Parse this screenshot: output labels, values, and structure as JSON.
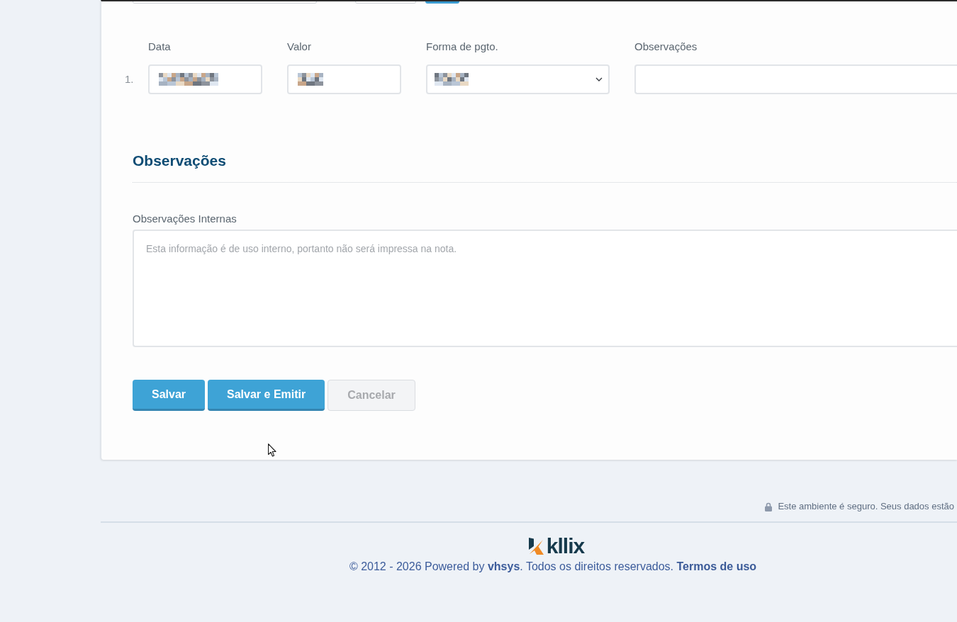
{
  "top_row": [
    {
      "kind": "input"
    },
    {
      "kind": "input"
    },
    {
      "kind": "button"
    }
  ],
  "payments": {
    "columns": [
      "Data",
      "Valor",
      "Forma de pgto.",
      "Observações"
    ],
    "rows": [
      {
        "number": "1.",
        "fields": [
          {
            "kind": "input",
            "redacted": true
          },
          {
            "kind": "input",
            "redacted": true
          },
          {
            "kind": "select",
            "redacted": true
          },
          {
            "kind": "input",
            "redacted": false
          }
        ]
      }
    ]
  },
  "notes_section": {
    "title": "Observações",
    "field_label": "Observações Internas",
    "placeholder": "Esta informação é de uso interno, portanto não será impressa na nota."
  },
  "buttons": [
    {
      "label": "Salvar",
      "kind": "primary"
    },
    {
      "label": "Salvar e Emitir",
      "kind": "primary"
    },
    {
      "label": "Cancelar",
      "kind": "secondary"
    }
  ],
  "mouse_pointer_shown": true,
  "security_note": "Este ambiente é seguro. Seus dados estão",
  "footer": {
    "logo": "kllix",
    "copyright": "© 2012 - 2026 Powered by **vhsys**. Todos os direitos reservados.",
    "terms_link": "Termos de uso"
  }
}
